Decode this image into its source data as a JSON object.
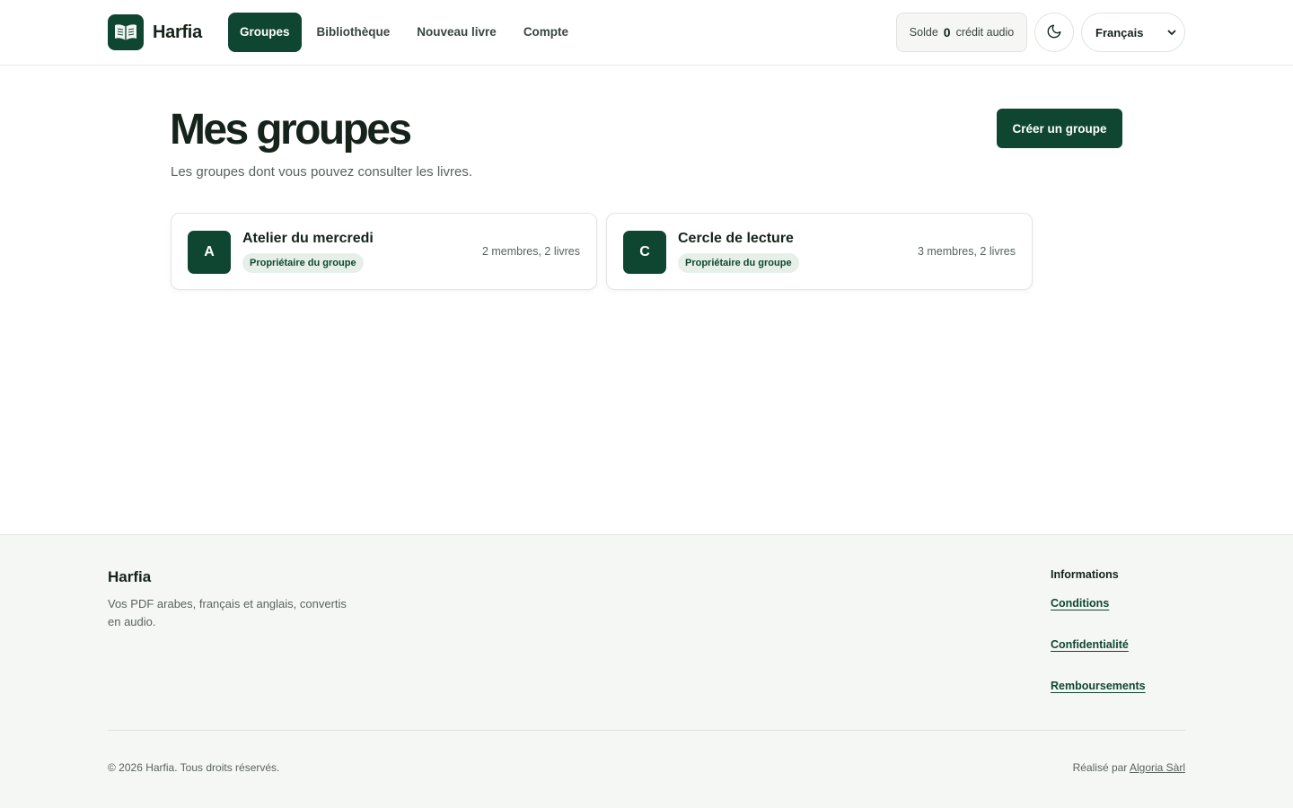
{
  "header": {
    "brand": "Harfia",
    "nav": [
      {
        "label": "Groupes",
        "active": true
      },
      {
        "label": "Bibliothèque",
        "active": false
      },
      {
        "label": "Nouveau livre",
        "active": false
      },
      {
        "label": "Compte",
        "active": false
      }
    ],
    "balance": {
      "label": "Solde",
      "amount": "0",
      "unit": "crédit audio"
    },
    "theme_toggle_icon": "moon-icon",
    "language": {
      "selected": "Français"
    }
  },
  "main": {
    "title": "Mes groupes",
    "subtitle": "Les groupes dont vous pouvez consulter les livres.",
    "create_button": "Créer un groupe",
    "groups": [
      {
        "initial": "A",
        "name": "Atelier du mercredi",
        "role": "Propriétaire du groupe",
        "meta": "2 membres, 2 livres"
      },
      {
        "initial": "C",
        "name": "Cercle de lecture",
        "role": "Propriétaire du groupe",
        "meta": "3 membres, 2 livres"
      }
    ]
  },
  "footer": {
    "brand": "Harfia",
    "description": "Vos PDF arabes, français et anglais, convertis en audio.",
    "info_heading": "Informations",
    "links": [
      "Conditions",
      "Confidentialité",
      "Remboursements"
    ],
    "copyright": "© 2026 Harfia. Tous droits réservés.",
    "credit_prefix": "Réalisé par",
    "credit_link": "Algoria Sàrl"
  },
  "colors": {
    "brand": "#0f4631",
    "footer_bg": "#f5f7f4",
    "badge_bg": "#e6f0e9"
  }
}
